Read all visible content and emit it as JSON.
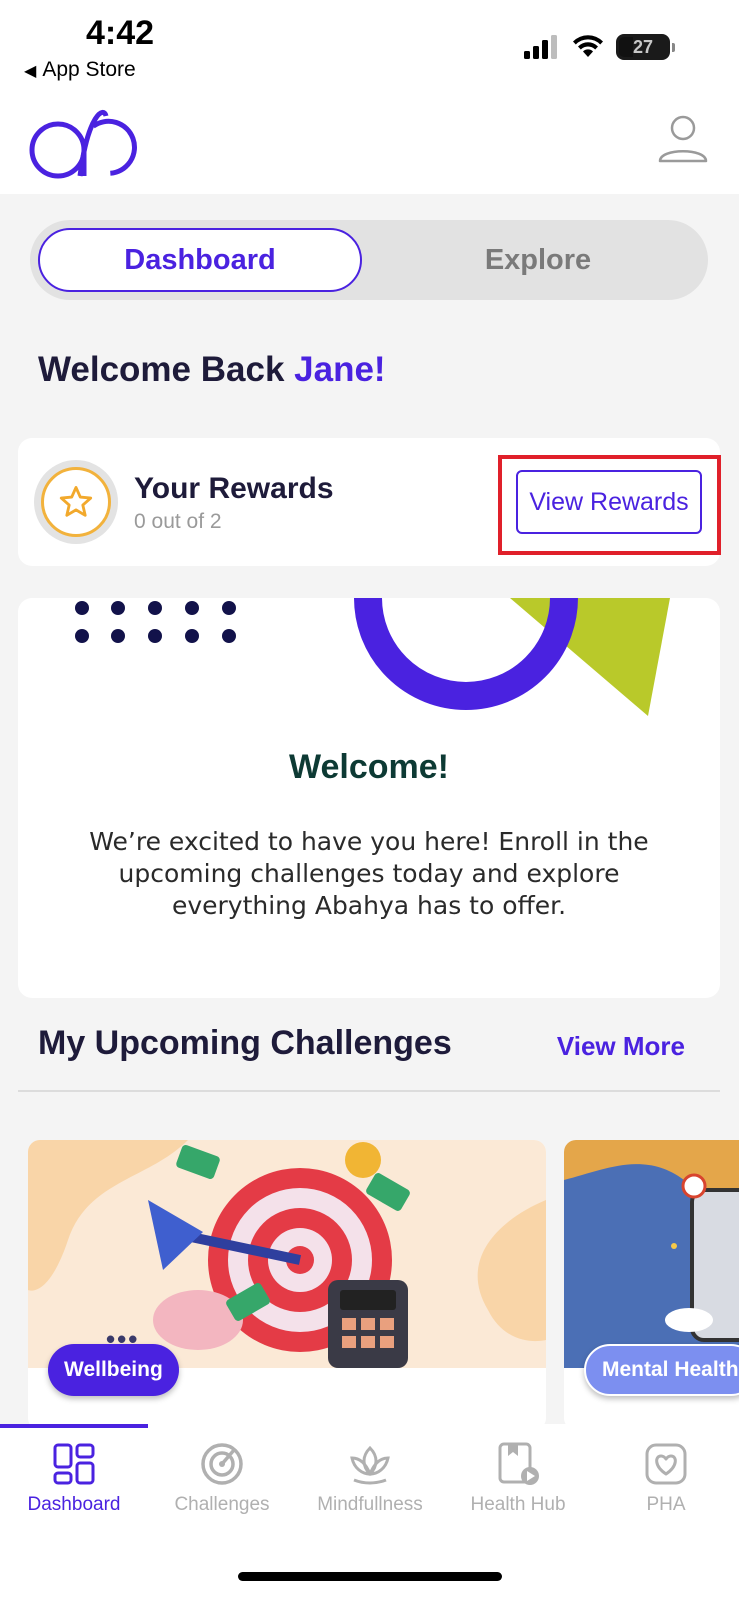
{
  "status_bar": {
    "time": "4:42",
    "back_label": "App Store",
    "battery": "27"
  },
  "header": {
    "logo_icon": "abahya-logo",
    "profile_icon": "user-profile-icon"
  },
  "tabs": [
    {
      "label": "Dashboard",
      "active": true
    },
    {
      "label": "Explore",
      "active": false
    }
  ],
  "greeting": {
    "prefix": "Welcome Back ",
    "name": "Jane!"
  },
  "rewards": {
    "title": "Your Rewards",
    "progress": "0 out of 2",
    "button_label": "View Rewards",
    "icon": "star-icon"
  },
  "welcome_card": {
    "heading": "Welcome!",
    "body": "We’re excited to have you here! Enroll in the upcoming challenges today and explore everything Abahya has to offer."
  },
  "challenges_section": {
    "title": "My Upcoming Challenges",
    "view_more_label": "View More",
    "cards": [
      {
        "category": "Wellbeing"
      },
      {
        "category": "Mental Health"
      }
    ]
  },
  "bottom_nav": [
    {
      "label": "Dashboard",
      "icon": "dashboard-icon",
      "active": true
    },
    {
      "label": "Challenges",
      "icon": "challenges-icon",
      "active": false
    },
    {
      "label": "Mindfullness",
      "icon": "lotus-icon",
      "active": false
    },
    {
      "label": "Health Hub",
      "icon": "health-hub-icon",
      "active": false
    },
    {
      "label": "PHA",
      "icon": "heart-icon",
      "active": false
    }
  ],
  "colors": {
    "accent": "#4a22e0",
    "highlight": "#e0202a",
    "lime": "#b9c92a"
  }
}
